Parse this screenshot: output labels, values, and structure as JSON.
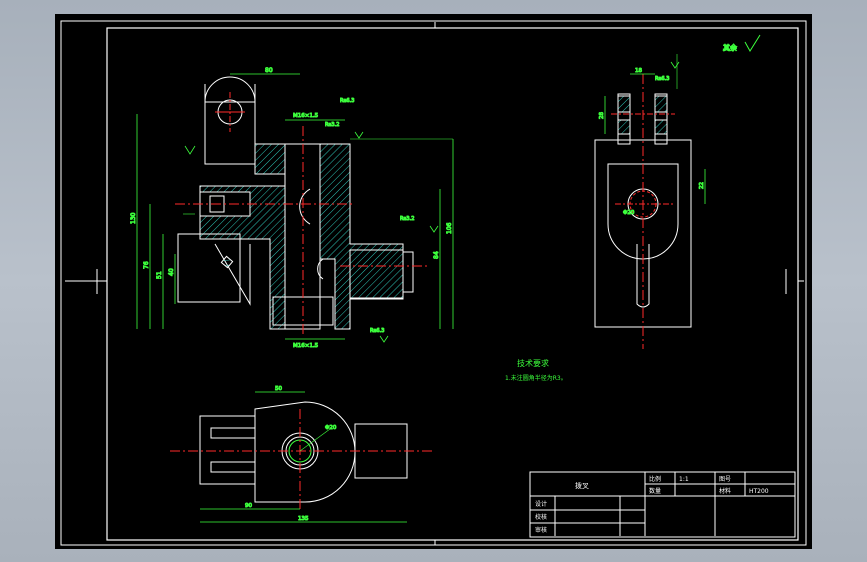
{
  "drawing": {
    "tech_requirements_title": "技术要求",
    "tech_requirements_note": "1.未注圆角半径为R3。",
    "title_block": {
      "part_name": "拨叉",
      "scale_label": "比例",
      "scale_value": "1:1",
      "drawing_no_label": "图号",
      "quantity_label": "数量",
      "material_label": "材料",
      "material_value": "HT200",
      "designer_label": "设计",
      "checker_label": "校核",
      "approver_label": "审核"
    },
    "dimensions": {
      "top_width": "80",
      "total_height": "130",
      "left_height_1": "76",
      "left_height_2": "51",
      "left_height_3": "40",
      "right_height_1": "106",
      "right_height_2": "84",
      "side_width": "30",
      "bottom_width_1": "90",
      "bottom_width_2": "135",
      "bottom_top_width": "50",
      "hole_diam": "Φ20",
      "thread_top": "M16×1.5",
      "thread_bottom": "M16×1.5",
      "side_top": "18",
      "side_height": "28",
      "side_right": "22",
      "surface_finish_a": "Ra3.2",
      "surface_finish_b": "Ra6.3",
      "other_finish": "其余"
    }
  }
}
